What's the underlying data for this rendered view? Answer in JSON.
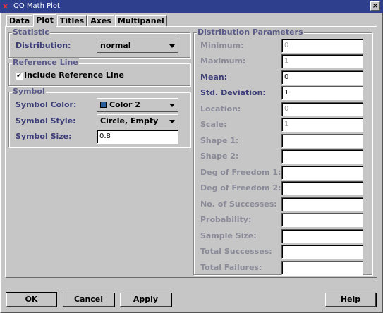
{
  "window": {
    "title": "QQ Math Plot",
    "close_glyph": "x"
  },
  "tabs": [
    {
      "label": "Data"
    },
    {
      "label": "Plot"
    },
    {
      "label": "Titles"
    },
    {
      "label": "Axes"
    },
    {
      "label": "Multipanel"
    }
  ],
  "statistic": {
    "legend": "Statistic",
    "distribution_label": "Distribution:",
    "distribution_value": "normal"
  },
  "reference_line": {
    "legend": "Reference Line",
    "include_label": "Include Reference Line",
    "include_checked": true,
    "check_glyph": "✔"
  },
  "symbol": {
    "legend": "Symbol",
    "color_label": "Symbol Color:",
    "color_value": "Color 2",
    "color_swatch": "#2a5d93",
    "style_label": "Symbol Style:",
    "style_value": "Circle, Empty",
    "size_label": "Symbol Size:",
    "size_value": "0.8"
  },
  "dist_params": {
    "legend": "Distribution Parameters",
    "params": [
      {
        "label": "Minimum:",
        "value": "0",
        "enabled": false
      },
      {
        "label": "Maximum:",
        "value": "1",
        "enabled": false
      },
      {
        "label": "Mean:",
        "value": "0",
        "enabled": true
      },
      {
        "label": "Std. Deviation:",
        "value": "1",
        "enabled": true
      },
      {
        "label": "Location:",
        "value": "0",
        "enabled": false
      },
      {
        "label": "Scale:",
        "value": "1",
        "enabled": false
      },
      {
        "label": "Shape 1:",
        "value": "",
        "enabled": false
      },
      {
        "label": "Shape 2:",
        "value": "",
        "enabled": false
      },
      {
        "label": "Deg of Freedom 1:",
        "value": "",
        "enabled": false
      },
      {
        "label": "Deg of Freedom 2:",
        "value": "",
        "enabled": false
      },
      {
        "label": "No. of Successes:",
        "value": "",
        "enabled": false
      },
      {
        "label": "Probability:",
        "value": "",
        "enabled": false
      },
      {
        "label": "Sample Size:",
        "value": "",
        "enabled": false
      },
      {
        "label": "Total Successes:",
        "value": "",
        "enabled": false
      },
      {
        "label": "Total Failures:",
        "value": "",
        "enabled": false
      }
    ]
  },
  "buttons": {
    "ok": "OK",
    "cancel": "Cancel",
    "apply": "Apply",
    "help": "Help"
  }
}
